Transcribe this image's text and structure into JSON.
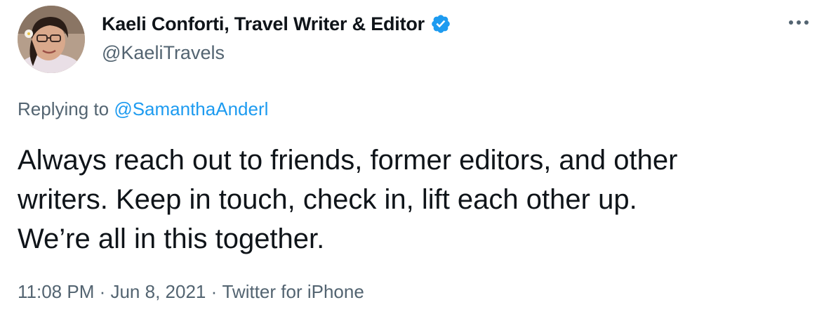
{
  "author": {
    "display_name": "Kaeli Conforti, Travel Writer & Editor",
    "handle": "@KaeliTravels",
    "verified": true,
    "verified_icon": "verified-badge-icon",
    "avatar_icon": "avatar-photo"
  },
  "more_icon": "more-horizontal-icon",
  "reply": {
    "prefix": "Replying to ",
    "mention": "@SamanthaAnderl"
  },
  "tweet": {
    "text": "Always reach out to friends, former editors, and other\nwriters. Keep in touch, check in, lift each other up.\nWe’re all in this together."
  },
  "meta": {
    "time": "11:08 PM",
    "separator": " · ",
    "date": "Jun 8, 2021",
    "source": "Twitter for iPhone"
  },
  "colors": {
    "text": "#0f1419",
    "secondary": "#536471",
    "accent": "#1d9bf0"
  }
}
